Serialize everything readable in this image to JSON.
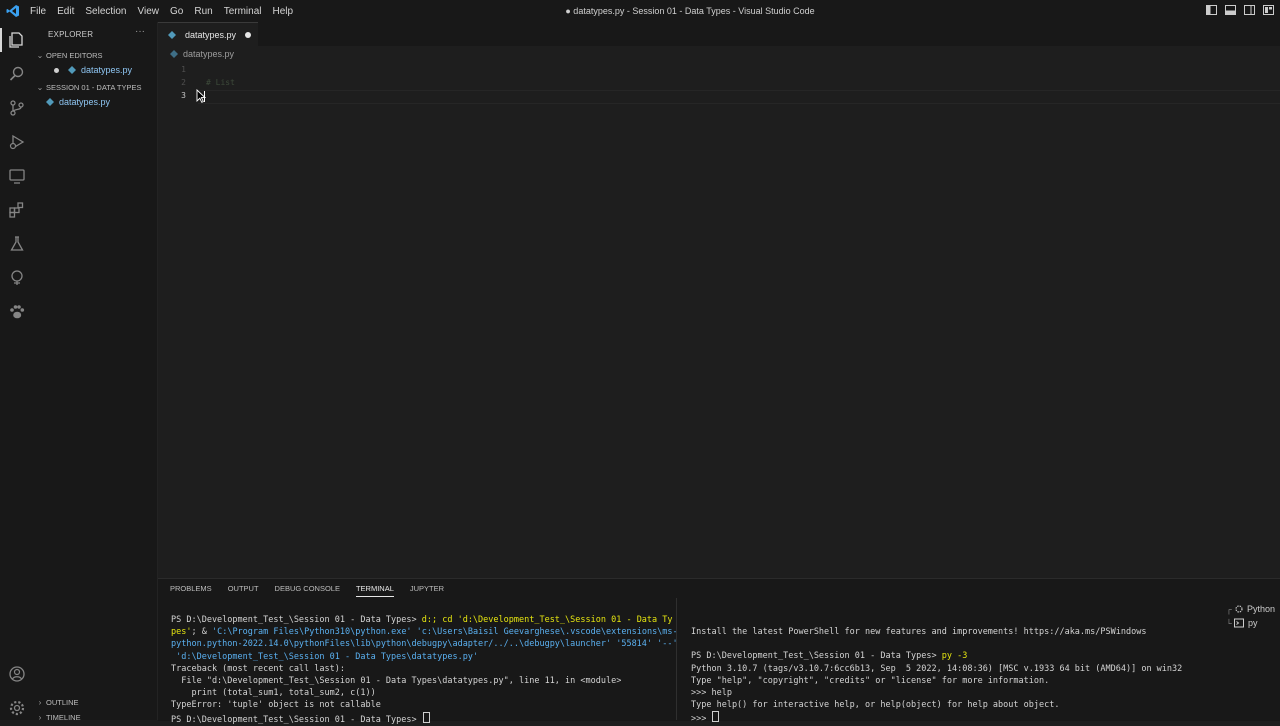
{
  "window": {
    "title": "● datatypes.py - Session 01 - Data Types - Visual Studio Code",
    "menu": [
      "File",
      "Edit",
      "Selection",
      "View",
      "Go",
      "Run",
      "Terminal",
      "Help"
    ]
  },
  "sidebar": {
    "header": "EXPLORER",
    "more": "···",
    "open_editors_label": "OPEN EDITORS",
    "open_editors_file": "datatypes.py",
    "folder_label": "SESSION 01 - DATA TYPES",
    "folder_file": "datatypes.py",
    "outline_label": "OUTLINE",
    "timeline_label": "TIMELINE"
  },
  "editor": {
    "tab_label": "datatypes.py",
    "breadcrumb": "datatypes.py",
    "line_numbers": [
      "1",
      "2",
      "3"
    ],
    "code_line_2": "# List",
    "code_line_3": ""
  },
  "panel": {
    "tabs": [
      "PROBLEMS",
      "OUTPUT",
      "DEBUG CONSOLE",
      "TERMINAL",
      "JUPYTER"
    ],
    "active_tab": "TERMINAL",
    "left": {
      "prompt1": "PS D:\\Development_Test_\\Session 01 - Data Types>",
      "cmd1": " d:; cd 'd:\\Development_Test_\\Session 01 - Data Ty",
      "line2a": "pes'",
      "line2b": "; & ",
      "line2c": "'C:\\Program Files\\Python310\\python.exe' 'c:\\Users\\Baisil Geevarghese\\.vscode\\extensions\\ms-",
      "line3": "python.python-2022.14.0\\pythonFiles\\lib\\python\\debugpy\\adapter/../..\\debugpy\\launcher' '55814' '--'",
      "line4": " 'd:\\Development_Test_\\Session 01 - Data Types\\datatypes.py'",
      "line5": "Traceback (most recent call last):",
      "line6": "  File \"d:\\Development_Test_\\Session 01 - Data Types\\datatypes.py\", line 11, in <module>",
      "line7": "    print (total_sum1, total_sum2, c(1))",
      "line8": "TypeError: 'tuple' object is not callable",
      "line9": "PS D:\\Development_Test_\\Session 01 - Data Types> "
    },
    "right": {
      "line1": "Install the latest PowerShell for new features and improvements! https://aka.ms/PSWindows",
      "line2": "PS D:\\Development_Test_\\Session 01 - Data Types>",
      "line2cmd": " py -3",
      "line3": "Python 3.10.7 (tags/v3.10.7:6cc6b13, Sep  5 2022, 14:08:36) [MSC v.1933 64 bit (AMD64)] on win32",
      "line4": "Type \"help\", \"copyright\", \"credits\" or \"license\" for more information.",
      "line5": ">>> help",
      "line6": "Type help() for interactive help, or help(object) for help about object.",
      "line7": ">>> "
    },
    "terminal_list": [
      "Python",
      "py"
    ]
  },
  "colors": {
    "accent": "#0078d4",
    "python_icon": "#519aba",
    "prompt_yellow": "#e5e510",
    "path_blue": "#5ab0f0"
  }
}
